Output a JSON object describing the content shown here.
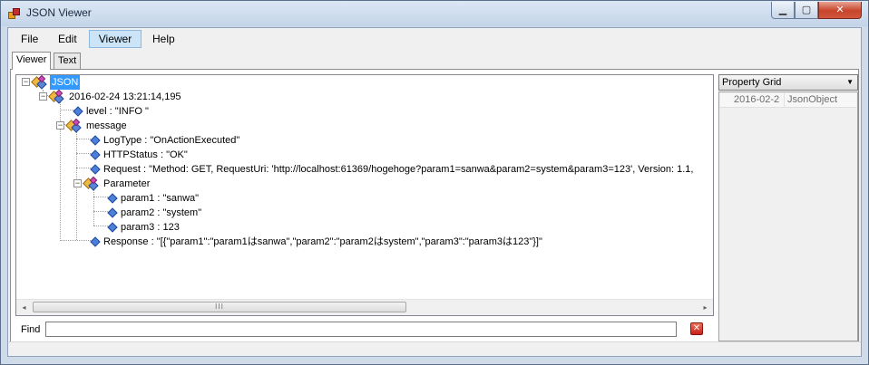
{
  "window": {
    "title": "JSON Viewer"
  },
  "menu": {
    "file": "File",
    "edit": "Edit",
    "viewer": "Viewer",
    "help": "Help"
  },
  "tabs": {
    "viewer": "Viewer",
    "text": "Text"
  },
  "tree": {
    "root": "JSON",
    "entry": "2016-02-24 13:21:14,195",
    "level": "level : \"INFO \"",
    "message": "message",
    "logtype": "LogType : \"OnActionExecuted\"",
    "httpstatus": "HTTPStatus : \"OK\"",
    "request": "Request : \"Method: GET, RequestUri: 'http://localhost:61369/hogehoge?param1=sanwa&param2=system&param3=123', Version: 1.1,",
    "parameter": "Parameter",
    "param1": "param1 : \"sanwa\"",
    "param2": "param2 : \"system\"",
    "param3": "param3 : 123",
    "response": "Response : \"[{\"param1\":\"param1はsanwa\",\"param2\":\"param2はsystem\",\"param3\":\"param3は123\"}]\""
  },
  "scrollbar": {
    "left_arrow": "◂",
    "right_arrow": "▸",
    "grip": "III"
  },
  "find": {
    "label": "Find",
    "value": ""
  },
  "property_grid": {
    "selector": "Property Grid",
    "row_name": "2016-02-2",
    "row_value": "JsonObject"
  },
  "colors": {
    "selection": "#3399ff",
    "accent_menu": "#cce4f7",
    "close_button": "#c7442a"
  }
}
